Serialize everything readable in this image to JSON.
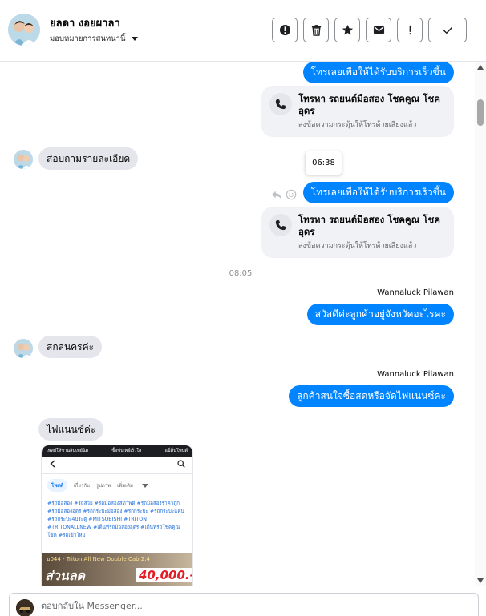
{
  "header": {
    "contact_name": "ยลดา งอยผาลา",
    "assign_label": "มอบหมายการสนทนานี้",
    "actions": [
      {
        "name": "spam-button",
        "icon": "alert-circle-icon"
      },
      {
        "name": "delete-button",
        "icon": "trash-icon"
      },
      {
        "name": "star-button",
        "icon": "star-icon"
      },
      {
        "name": "mark-unread-button",
        "icon": "envelope-icon"
      },
      {
        "name": "follow-up-button",
        "icon": "exclamation-icon"
      },
      {
        "name": "done-button",
        "icon": "check-icon"
      }
    ]
  },
  "messages": {
    "out_1": "โทรเลยเพื่อให้ได้รับบริการเร็วขึ้น",
    "call_card_1": {
      "title": "โทรหา รถยนต์มือสอง โชคคูณ โชค อุดร",
      "subtitle": "ส่งข้อความกระตุ้นให้โทรด้วยเสียงแล้ว"
    },
    "in_1": "สอบถามรายละเอียด",
    "time_chip": "06:38",
    "out_2": "โทรเลยเพื่อให้ได้รับบริการเร็วขึ้น",
    "call_card_2": {
      "title": "โทรหา รถยนต์มือสอง โชคคูณ โชค อุดร",
      "subtitle": "ส่งข้อความกระตุ้นให้โทรด้วยเสียงแล้ว"
    },
    "time_divider": "08:05",
    "sender_1": "Wannaluck Pilawan",
    "out_3": "สวัสดีค่ะลูกค้าอยู่จังหวัดอะไรคะ",
    "in_2": "สกลนครค่ะ",
    "sender_2": "Wannaluck Pilawan",
    "out_4": "ลูกค้าสนใจซื้อสดหรือจัดไฟแนนซ์คะ",
    "in_3": "ไฟแนนซ์ค่ะ"
  },
  "attachment": {
    "topbar_left": "เพลย์ให้ชานลินเพย์นิด",
    "topbar_mid": "ซื้อขับเพย์เร็วใส",
    "topbar_right": "แม็ค็นโพนต์",
    "tabs": [
      "โพสต์",
      "เกี่ยวกับ",
      "รูปภาพ",
      "เพิ่มเติม"
    ],
    "hashtags": "#รถมือสอง #รถสวย #รถมือสองสภาพดี #รถมือสองราคาถูก #รถมือสองอุดร #รถกระบะมือสอง #รถกระบะ #รถกระบะแคป #รถกระบะ4ประตู #MITSUBISHI #TRITON #TRITONALLNEW #เต็นท์รถมือสองอุดร #เต็นท์รถโชคคูณโชค #รถเข้าใหม่",
    "banner_line1": "บ044 - Triton All New Double Cab 2.4",
    "banner_line2": "ส่วนลด",
    "banner_line3": "40,000.-"
  },
  "composer": {
    "placeholder": "ตอบกลับใน Messenger..."
  },
  "colors": {
    "accent": "#0084ff",
    "incoming_bubble": "#e4e6eb",
    "card_bg": "#f0f2f5"
  }
}
